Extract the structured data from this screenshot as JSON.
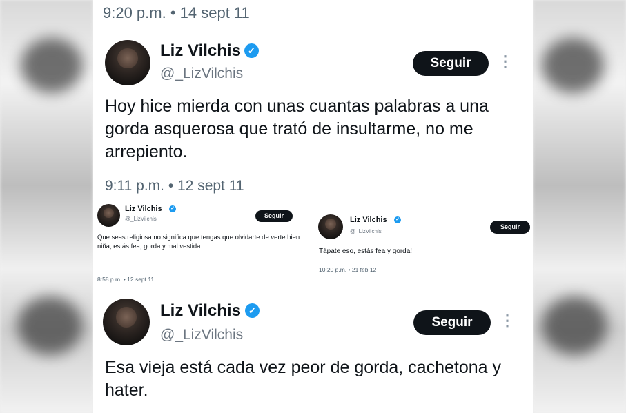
{
  "top_timestamp": "9:20 p.m. • 14 sept 11",
  "tweets": [
    {
      "name": "Liz Vilchis",
      "handle": "@_LizVilchis",
      "follow_label": "Seguir",
      "more_icon": "⋮",
      "text": "Hoy hice mierda con unas cuantas palabras a una gorda asquerosa que trató de insultarme, no me arrepiento.",
      "timestamp": "9:11 p.m. • 12 sept 11"
    },
    {
      "name": "Liz Vilchis",
      "handle": "@_LizVilchis",
      "follow_label": "Seguir",
      "text": "Que seas religiosa no significa que tengas que olvidarte de verte bien niña, estás fea, gorda y mal vestida.",
      "timestamp": "8:58 p.m. • 12 sept 11"
    },
    {
      "name": "Liz Vilchis",
      "handle": "@_LizVilchis",
      "follow_label": "Seguir",
      "text": "Tápate eso, estás fea y gorda!",
      "timestamp": "10:20 p.m. • 21 feb 12"
    },
    {
      "name": "Liz Vilchis",
      "handle": "@_LizVilchis",
      "follow_label": "Seguir",
      "more_icon": "⋮",
      "text": "Esa vieja está cada vez peor de gorda, cachetona y hater."
    }
  ],
  "icons": {
    "verified": "verified-badge-icon",
    "more": "more-options-icon"
  },
  "colors": {
    "verified": "#1d9bf0",
    "follow_button": "#0f1419",
    "text": "#0f1419",
    "secondary": "#536471"
  }
}
